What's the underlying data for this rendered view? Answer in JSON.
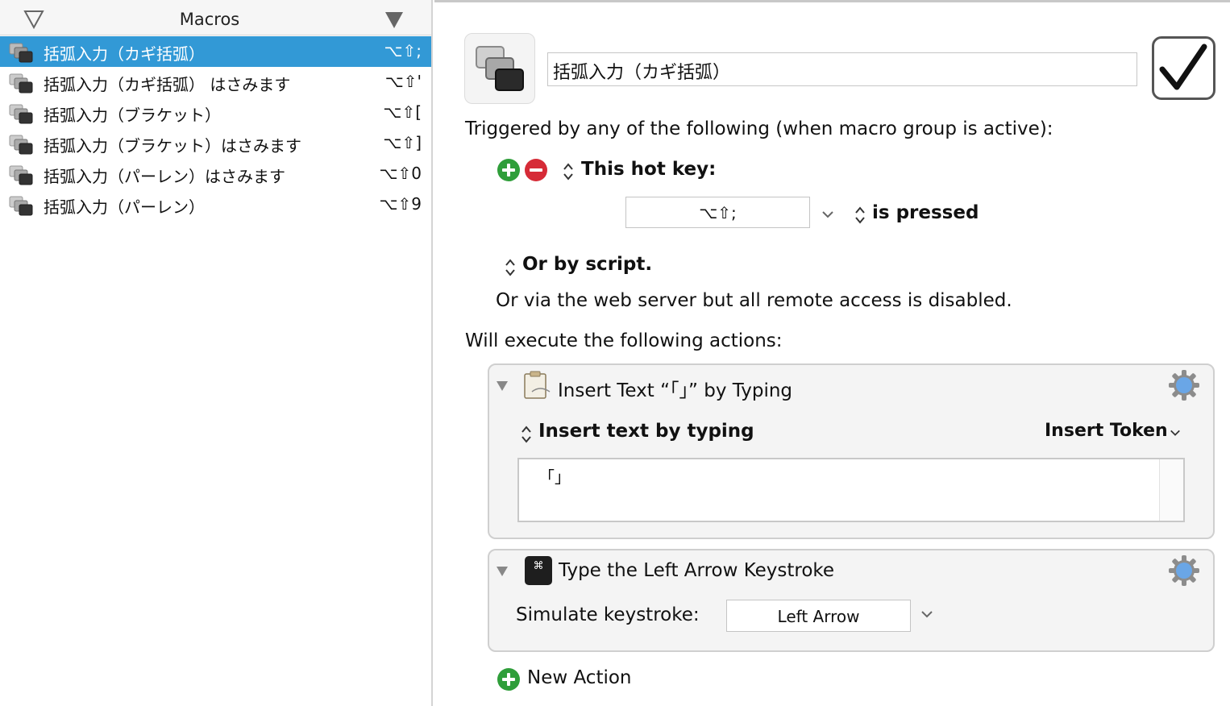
{
  "sidebar": {
    "header_title": "Macros",
    "macros": [
      {
        "name": "括弧入力（カギ括弧）",
        "hotkey": "⌥⇧;",
        "selected": true
      },
      {
        "name": "括弧入力（カギ括弧） はさみます",
        "hotkey": "⌥⇧'",
        "selected": false
      },
      {
        "name": "括弧入力（ブラケット）",
        "hotkey": "⌥⇧[",
        "selected": false
      },
      {
        "name": "括弧入力（ブラケット）はさみます",
        "hotkey": "⌥⇧]",
        "selected": false
      },
      {
        "name": "括弧入力（パーレン）はさみます",
        "hotkey": "⌥⇧0",
        "selected": false
      },
      {
        "name": "括弧入力（パーレン）",
        "hotkey": "⌥⇧9",
        "selected": false
      }
    ]
  },
  "editor": {
    "macro_name": "括弧入力（カギ括弧）",
    "enabled": true,
    "triggered_text": "Triggered by any of the following (when macro group is active):",
    "trigger_type": "This hot key:",
    "hotkey_value": "⌥⇧;",
    "hotkey_condition": "is pressed",
    "or_by_script": "Or by script.",
    "web_server_text": "Or via the web server but all remote access is disabled.",
    "will_execute": "Will execute the following actions:",
    "actions": [
      {
        "title": "Insert Text “「」” by Typing",
        "mode": "Insert text by typing",
        "insert_token": "Insert Token",
        "text": "「」"
      },
      {
        "title": "Type the Left Arrow Keystroke",
        "simulate_label": "Simulate keystroke:",
        "keystroke": "Left Arrow"
      }
    ],
    "new_action": "New Action"
  },
  "colors": {
    "selection": "#3299d6",
    "plus_green": "#2f9e3a",
    "minus_red": "#d62b37",
    "gear_blue": "#6aa6e6"
  }
}
